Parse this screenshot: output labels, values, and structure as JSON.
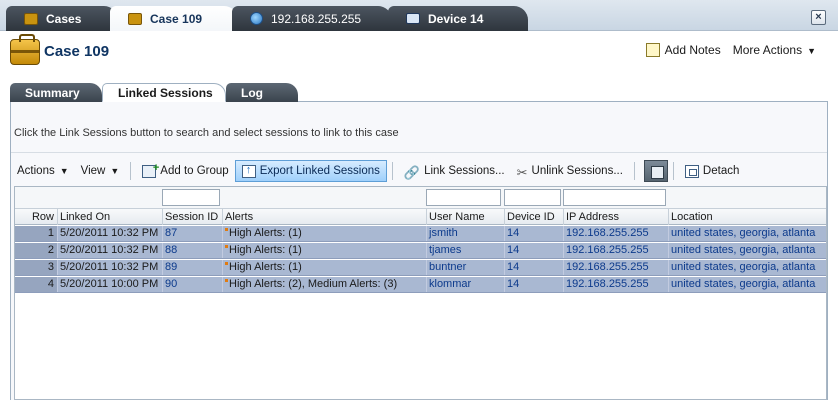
{
  "window": {
    "tabs": [
      {
        "label": "Cases",
        "icon": "briefcase-icon",
        "active": false
      },
      {
        "label": "Case 109",
        "icon": "briefcase-icon",
        "active": true
      },
      {
        "label": "192.168.255.255",
        "icon": "globe-icon",
        "active": false
      },
      {
        "label": "Device 14",
        "icon": "monitor-icon",
        "active": false
      }
    ],
    "close_icon": "close-icon"
  },
  "header": {
    "title": "Case 109",
    "add_notes": "Add Notes",
    "more_actions": "More Actions"
  },
  "subtabs": [
    {
      "label": "Summary",
      "active": false
    },
    {
      "label": "Linked Sessions",
      "active": true
    },
    {
      "label": "Log",
      "active": false
    }
  ],
  "instruction": "Click the Link Sessions button to search and select sessions to link to this case",
  "toolbar": {
    "actions": "Actions",
    "view": "View",
    "add_to_group": "Add to Group",
    "export_linked_sessions": "Export Linked Sessions",
    "link_sessions": "Link Sessions...",
    "unlink_sessions": "Unlink Sessions...",
    "detach": "Detach"
  },
  "table": {
    "columns": [
      "Row",
      "Linked On",
      "Session ID",
      "Alerts",
      "User Name",
      "Device ID",
      "IP Address",
      "Location"
    ],
    "rows": [
      {
        "row": "1",
        "linked_on": "5/20/2011 10:32 PM",
        "session_id": "87",
        "alerts": "High Alerts: (1)",
        "user": "jsmith",
        "device_id": "14",
        "ip": "192.168.255.255",
        "location": "united states, georgia, atlanta"
      },
      {
        "row": "2",
        "linked_on": "5/20/2011 10:32 PM",
        "session_id": "88",
        "alerts": "High Alerts: (1)",
        "user": "tjames",
        "device_id": "14",
        "ip": "192.168.255.255",
        "location": "united states, georgia, atlanta"
      },
      {
        "row": "3",
        "linked_on": "5/20/2011 10:32 PM",
        "session_id": "89",
        "alerts": "High Alerts: (1)",
        "user": "buntner",
        "device_id": "14",
        "ip": "192.168.255.255",
        "location": "united states, georgia, atlanta"
      },
      {
        "row": "4",
        "linked_on": "5/20/2011 10:00 PM",
        "session_id": "90",
        "alerts": "High Alerts: (2), Medium Alerts: (3)",
        "user": "klommar",
        "device_id": "14",
        "ip": "192.168.255.255",
        "location": "united states, georgia, atlanta"
      }
    ]
  },
  "colors": {
    "selected_row": "#a9b8d2",
    "link_text": "#0c3a8c",
    "title_text": "#0f3563"
  }
}
